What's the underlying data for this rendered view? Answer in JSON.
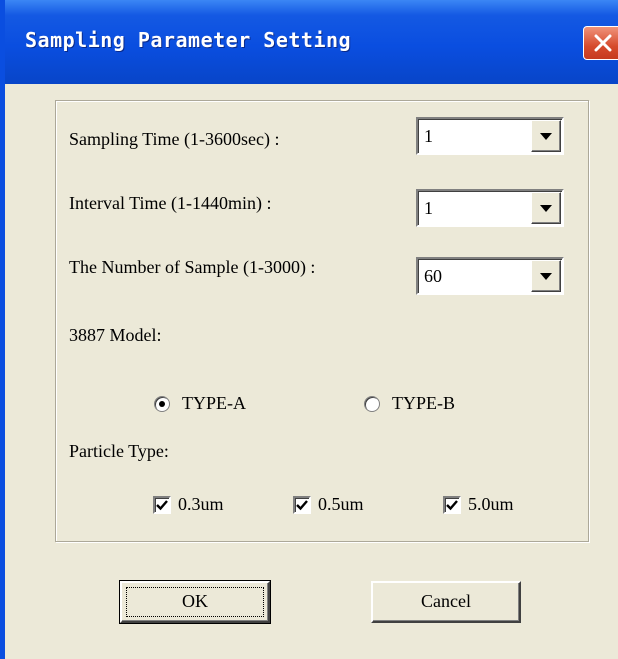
{
  "window": {
    "title": "Sampling Parameter Setting",
    "close_icon": "close-icon",
    "accent_color": "#0a4ee0"
  },
  "fields": {
    "sampling_time": {
      "label": "Sampling Time (1-3600sec) :",
      "value": "1"
    },
    "interval_time": {
      "label": "Interval Time (1-1440min) :",
      "value": "1"
    },
    "sample_count": {
      "label": "The Number of Sample (1-3000) :",
      "value": "60"
    }
  },
  "model": {
    "label": "3887 Model:",
    "options": [
      {
        "label": "TYPE-A",
        "selected": true
      },
      {
        "label": "TYPE-B",
        "selected": false
      }
    ]
  },
  "particle": {
    "label": "Particle Type:",
    "options": [
      {
        "label": "0.3um",
        "checked": true
      },
      {
        "label": "0.5um",
        "checked": true
      },
      {
        "label": "5.0um",
        "checked": true
      }
    ]
  },
  "buttons": {
    "ok": "OK",
    "cancel": "Cancel"
  }
}
